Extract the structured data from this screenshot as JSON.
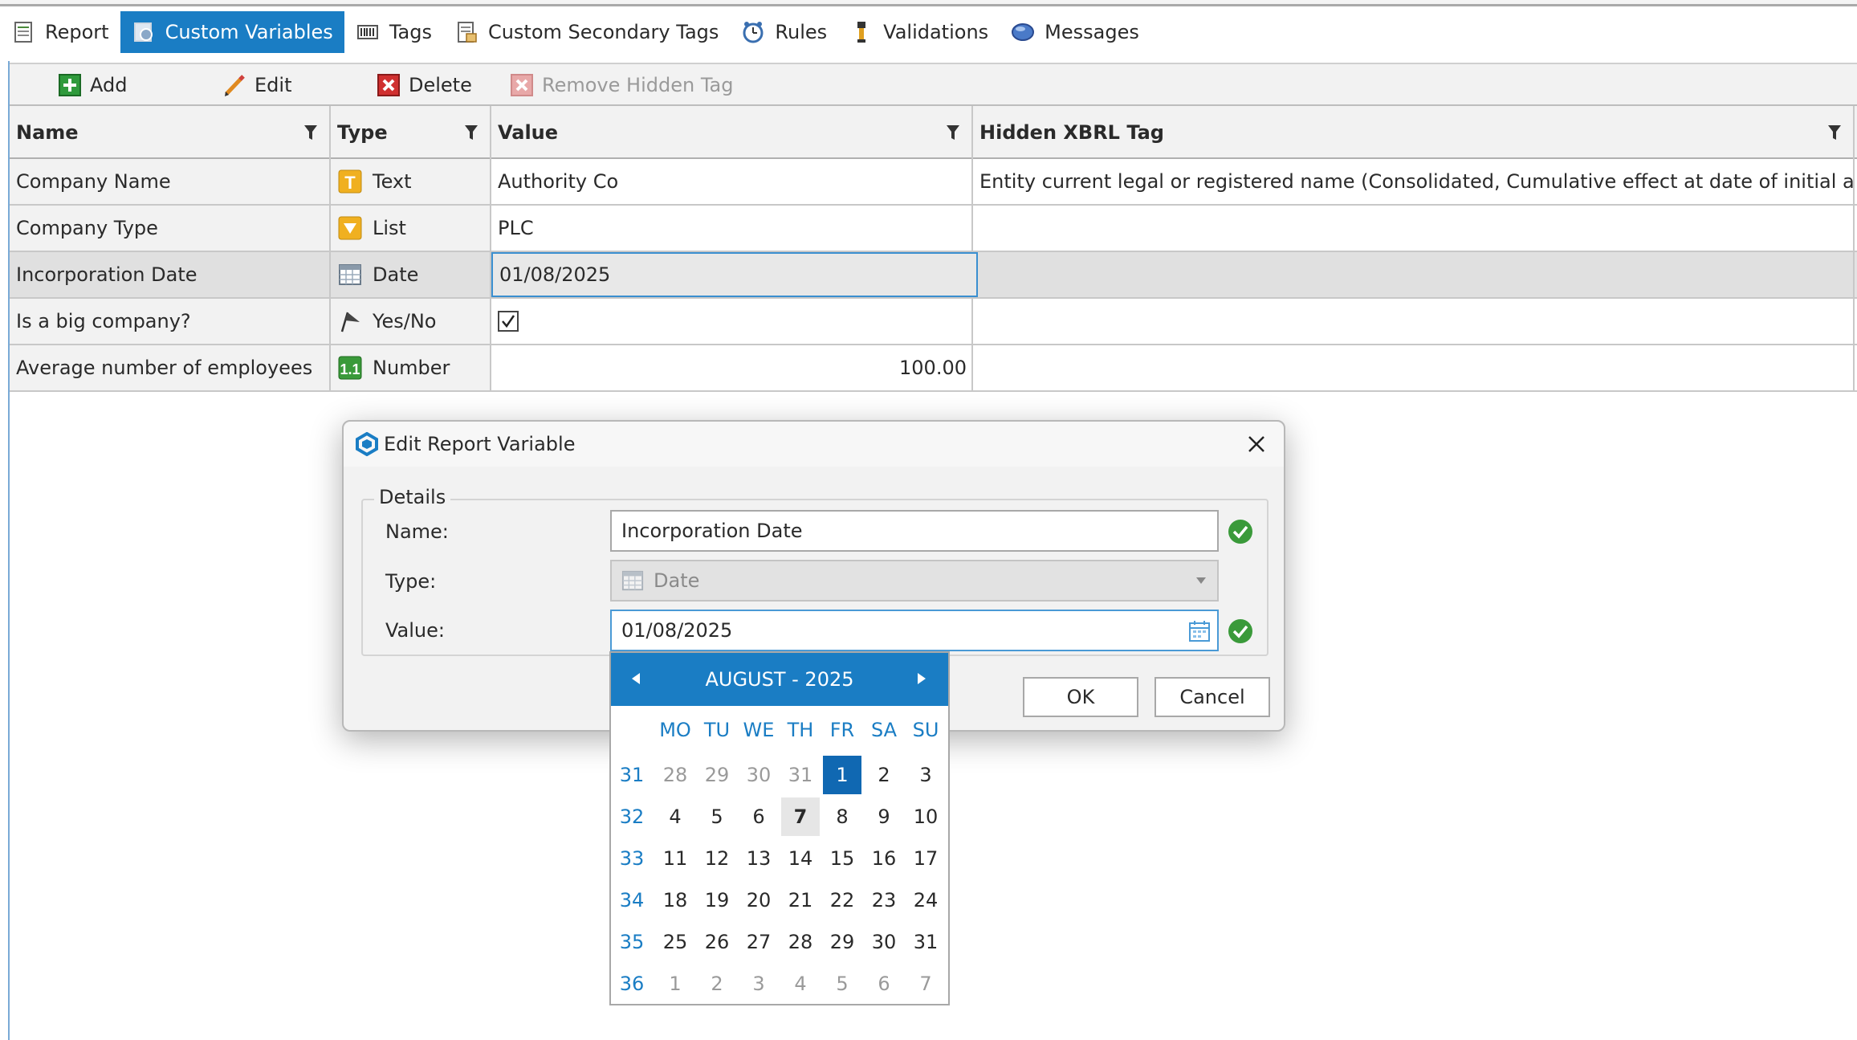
{
  "tabs": [
    {
      "label": "Report",
      "icon": "report-icon"
    },
    {
      "label": "Custom Variables",
      "icon": "custom-variables-icon",
      "active": true
    },
    {
      "label": "Tags",
      "icon": "tags-icon"
    },
    {
      "label": "Custom Secondary Tags",
      "icon": "secondary-tags-icon"
    },
    {
      "label": "Rules",
      "icon": "clock-icon"
    },
    {
      "label": "Validations",
      "icon": "validations-icon"
    },
    {
      "label": "Messages",
      "icon": "messages-icon"
    }
  ],
  "toolbar": {
    "add_label": "Add",
    "edit_label": "Edit",
    "delete_label": "Delete",
    "remove_hidden_tag_label": "Remove Hidden Tag"
  },
  "grid": {
    "columns": [
      "Name",
      "Type",
      "Value",
      "Hidden XBRL Tag"
    ],
    "rows": [
      {
        "name": "Company Name",
        "type": "Text",
        "type_icon": "text-type-icon",
        "value": "Authority Co",
        "tag": "Entity current legal or registered name (Consolidated, Cumulative effect at date of initial application, in"
      },
      {
        "name": "Company Type",
        "type": "List",
        "type_icon": "list-type-icon",
        "value": "PLC",
        "tag": ""
      },
      {
        "name": "Incorporation Date",
        "type": "Date",
        "type_icon": "date-type-icon",
        "value": "01/08/2025",
        "tag": "",
        "selected": true
      },
      {
        "name": "Is a big company?",
        "type": "Yes/No",
        "type_icon": "flag-type-icon",
        "value": "",
        "checked": true,
        "tag": ""
      },
      {
        "name": "Average number of employees",
        "type": "Number",
        "type_icon": "number-type-icon",
        "value": "100.00",
        "tag": ""
      }
    ]
  },
  "dialog": {
    "title": "Edit Report Variable",
    "group_label": "Details",
    "name_label": "Name:",
    "name_value": "Incorporation Date",
    "type_label": "Type:",
    "type_value": "Date",
    "value_label": "Value:",
    "value_value": "01/08/2025",
    "ok_label": "OK",
    "cancel_label": "Cancel"
  },
  "calendar": {
    "header": "AUGUST - 2025",
    "weekdays": [
      "MO",
      "TU",
      "WE",
      "TH",
      "FR",
      "SA",
      "SU"
    ],
    "weeks": [
      {
        "num": "31",
        "days": [
          {
            "d": "28",
            "o": true
          },
          {
            "d": "29",
            "o": true
          },
          {
            "d": "30",
            "o": true
          },
          {
            "d": "31",
            "o": true
          },
          {
            "d": "1",
            "sel": true
          },
          {
            "d": "2"
          },
          {
            "d": "3"
          }
        ]
      },
      {
        "num": "32",
        "days": [
          {
            "d": "4"
          },
          {
            "d": "5"
          },
          {
            "d": "6"
          },
          {
            "d": "7",
            "today": true
          },
          {
            "d": "8"
          },
          {
            "d": "9"
          },
          {
            "d": "10"
          }
        ]
      },
      {
        "num": "33",
        "days": [
          {
            "d": "11"
          },
          {
            "d": "12"
          },
          {
            "d": "13"
          },
          {
            "d": "14"
          },
          {
            "d": "15"
          },
          {
            "d": "16"
          },
          {
            "d": "17"
          }
        ]
      },
      {
        "num": "34",
        "days": [
          {
            "d": "18"
          },
          {
            "d": "19"
          },
          {
            "d": "20"
          },
          {
            "d": "21"
          },
          {
            "d": "22"
          },
          {
            "d": "23"
          },
          {
            "d": "24"
          }
        ]
      },
      {
        "num": "35",
        "days": [
          {
            "d": "25"
          },
          {
            "d": "26"
          },
          {
            "d": "27"
          },
          {
            "d": "28"
          },
          {
            "d": "29"
          },
          {
            "d": "30"
          },
          {
            "d": "31"
          }
        ]
      },
      {
        "num": "36",
        "days": [
          {
            "d": "1",
            "o": true
          },
          {
            "d": "2",
            "o": true
          },
          {
            "d": "3",
            "o": true
          },
          {
            "d": "4",
            "o": true
          },
          {
            "d": "5",
            "o": true
          },
          {
            "d": "6",
            "o": true
          },
          {
            "d": "7",
            "o": true
          }
        ]
      }
    ]
  },
  "colors": {
    "accent": "#1a7dc4",
    "selected_day": "#1068b2",
    "valid_green": "#3a9a3a"
  }
}
